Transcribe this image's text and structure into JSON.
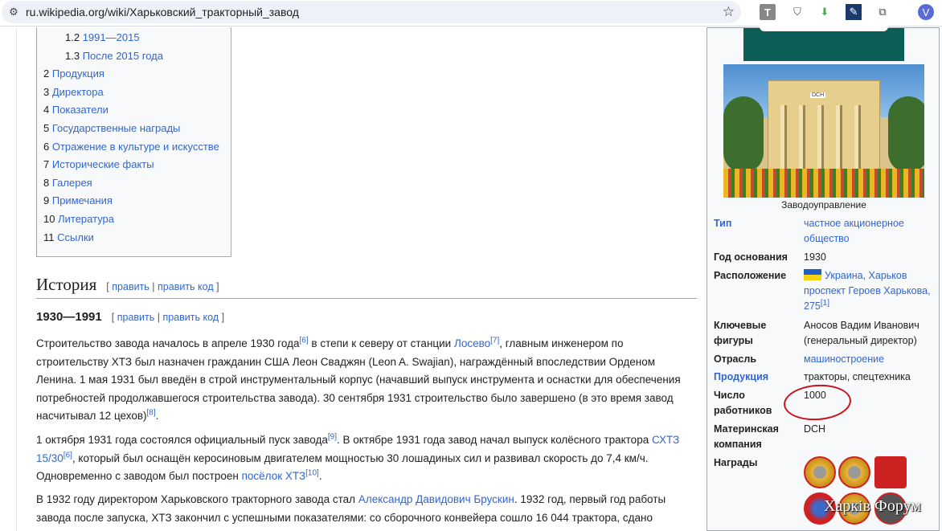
{
  "browser": {
    "url": "ru.wikipedia.org/wiki/Харьковский_тракторный_завод",
    "profile_initial": "V"
  },
  "toc": [
    {
      "num": "1.2",
      "label": "1991—2015"
    },
    {
      "num": "1.3",
      "label": "После 2015 года"
    },
    {
      "num": "2",
      "label": "Продукция"
    },
    {
      "num": "3",
      "label": "Директора"
    },
    {
      "num": "4",
      "label": "Показатели"
    },
    {
      "num": "5",
      "label": "Государственные награды"
    },
    {
      "num": "6",
      "label": "Отражение в культуре и искусстве"
    },
    {
      "num": "7",
      "label": "Исторические факты"
    },
    {
      "num": "8",
      "label": "Галерея"
    },
    {
      "num": "9",
      "label": "Примечания"
    },
    {
      "num": "10",
      "label": "Литература"
    },
    {
      "num": "11",
      "label": "Ссылки"
    }
  ],
  "section": {
    "title": "История",
    "edit": "править",
    "edit_code": "править код",
    "open": "[",
    "sep": "|",
    "close": "]"
  },
  "subsection": {
    "title": "1930—1991"
  },
  "paragraphs": {
    "p1": {
      "a": "Строительство завода началось в апреле 1930 года",
      "r1": "[6]",
      "b": " в степи к северу от станции ",
      "link1": "Лосево",
      "r2": "[7]",
      "c": ", главным инженером по строительству ХТЗ был назначен гражданин США Леон Сваджян (Leon A. Swajian), награждённый впоследствии Орденом Ленина. 1 мая 1931 был введён в строй инструментальный корпус (начавший выпуск инструмента и оснастки для обеспечения потребностей продолжавшегося строительства завода). 30 сентября 1931 строительство было завершено (в это время завод насчитывал 12 цехов)",
      "r3": "[8]",
      "d": "."
    },
    "p2": {
      "a": "1 октября 1931 года состоялся официальный пуск завода",
      "r1": "[9]",
      "b": ". В октябре 1931 года завод начал выпуск колёсного трактора ",
      "link1": "СХТЗ 15/30",
      "r2": "[6]",
      "c": ", который был оснащён керосиновым двигателем мощностью 30 лошадиных сил и развивал скорость до 7,4 км/ч. Одновременно с заводом был построен ",
      "link2": "посёлок ХТЗ",
      "r3": "[10]",
      "d": "."
    },
    "p3": {
      "a": "В 1932 году директором Харьковского тракторного завода стал ",
      "link1": "Александр Давидович Брускин",
      "b": ". 1932 год, первый год работы завода после запуска, ХТЗ закончил с успешными показателями: со сборочного конвейера сошло 16 044 трактора, сдано"
    }
  },
  "infobox": {
    "caption": "Заводоуправление",
    "photo_sign": "DCH",
    "rows": [
      {
        "label": "Тип",
        "value": "частное акционерное общество"
      },
      {
        "label": "Год основания",
        "value": "1930"
      },
      {
        "label": "Расположение",
        "value": "Украина, Харьков",
        "value2": "проспект Героев Харькова, 275",
        "ref": "[1]"
      },
      {
        "label": "Ключевые фигуры",
        "value": "Аносов Вадим Иванович (генеральный директор)"
      },
      {
        "label": "Отрасль",
        "value": "машиностроение"
      },
      {
        "label": "Продукция",
        "value": "тракторы, спецтехника"
      },
      {
        "label": "Число работников",
        "value": "1000"
      },
      {
        "label": "Материнская компания",
        "value": "DCH"
      },
      {
        "label": "Награды",
        "value": ""
      }
    ],
    "watermark": "Харків Форум"
  }
}
